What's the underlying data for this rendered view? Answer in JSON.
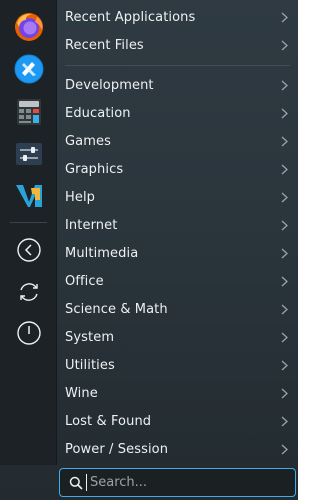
{
  "favorites": [
    {
      "name": "firefox-icon"
    },
    {
      "name": "plasma-discover-icon"
    },
    {
      "name": "calculator-icon"
    },
    {
      "name": "system-settings-icon"
    },
    {
      "name": "vscodium-icon"
    }
  ],
  "system_buttons": [
    {
      "name": "leave-icon"
    },
    {
      "name": "restart-icon"
    },
    {
      "name": "shutdown-icon"
    }
  ],
  "recent": [
    {
      "label": "Recent Applications"
    },
    {
      "label": "Recent Files"
    }
  ],
  "categories": [
    {
      "label": "Development"
    },
    {
      "label": "Education"
    },
    {
      "label": "Games"
    },
    {
      "label": "Graphics"
    },
    {
      "label": "Help"
    },
    {
      "label": "Internet"
    },
    {
      "label": "Multimedia"
    },
    {
      "label": "Office"
    },
    {
      "label": "Science & Math"
    },
    {
      "label": "System"
    },
    {
      "label": "Utilities"
    },
    {
      "label": "Wine"
    },
    {
      "label": "Lost & Found"
    },
    {
      "label": "Power / Session"
    }
  ],
  "search": {
    "placeholder": "Search...",
    "value": ""
  },
  "colors": {
    "accent": "#3daee9",
    "text": "#eef1f3"
  }
}
